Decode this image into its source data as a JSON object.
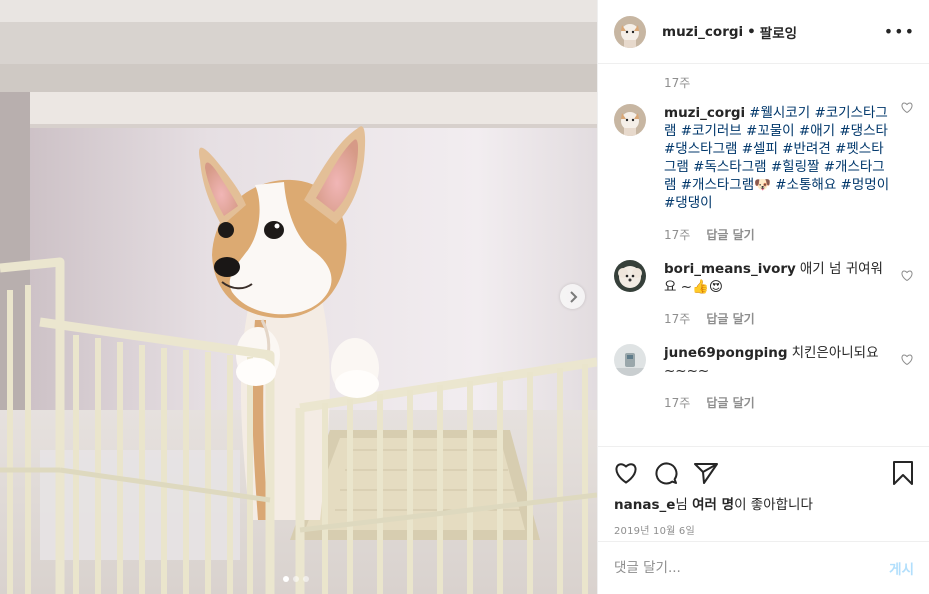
{
  "post": {
    "username": "muzi_corgi",
    "separator": "•",
    "follow_label": "팔로잉",
    "more_label": "•••",
    "time_top": "17주"
  },
  "caption": {
    "username": "muzi_corgi",
    "hashtags": [
      "#웰시코기",
      "#코기스타그램",
      "#코기러브",
      "#꼬물이",
      "#애기",
      "#댕스타",
      "#댕스타그램",
      "#셀피",
      "#반려견",
      "#펫스타그램",
      "#독스타그램",
      "#힐링짤",
      "#개스타그램",
      "#개스타그램🐶",
      "#소통해요",
      "#멍멍이",
      "#댕댕이"
    ],
    "time": "17주",
    "reply_label": "답글 달기"
  },
  "comments": [
    {
      "username": "bori_means_ivory",
      "text": "애기 넘 귀여워요 ~👍😍",
      "time": "17주",
      "reply_label": "답글 달기"
    },
    {
      "username": "june69pongping",
      "text": "치킨은아니되요 ~~~~",
      "time": "17주",
      "reply_label": "답글 달기"
    }
  ],
  "likes": {
    "user": "nanas_e",
    "mid": "님 ",
    "others": "여러 명",
    "suffix": "이 좋아합니다"
  },
  "date": "2019년 10월 6일",
  "add_comment": {
    "placeholder": "댓글 달기...",
    "post_label": "게시"
  },
  "carousel": {
    "current": 1,
    "total": 3
  },
  "icons": {
    "like": "heart-icon",
    "comment": "comment-icon",
    "share": "paper-plane-icon",
    "save": "bookmark-icon",
    "next": "chevron-right-icon"
  },
  "colors": {
    "hashtag": "#00376b",
    "meta": "#8e8e8e",
    "post_button": "#b2dffc",
    "border": "#efefef"
  }
}
